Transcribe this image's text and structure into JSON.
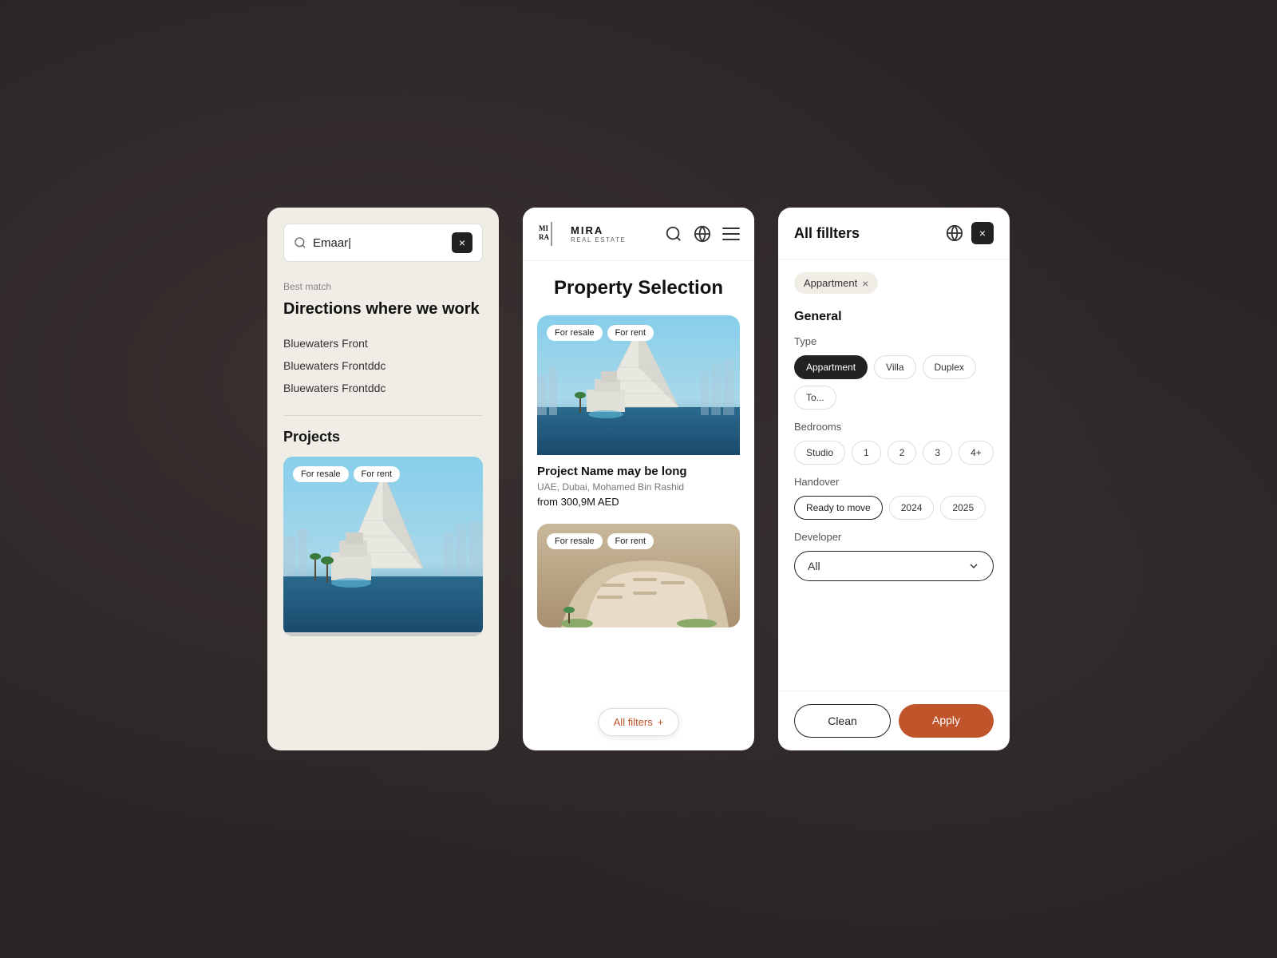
{
  "panel1": {
    "search_value": "Emaar|",
    "close_label": "×",
    "best_match": "Best match",
    "directions_heading": "Directions where we work",
    "locations": [
      "Bluewaters Front",
      "Bluewaters Frontddc",
      "Bluewaters Frontddc"
    ],
    "projects_heading": "Projects",
    "project_badge1": "For resale",
    "project_badge2": "For rent"
  },
  "panel2": {
    "logo_text": "MIRA",
    "logo_sub": "REAL ESTATE",
    "title": "Property Selection",
    "card1": {
      "badge1": "For resale",
      "badge2": "For rent",
      "name": "Project Name may be long",
      "location": "UAE, Dubai, Mohamed Bin Rashid",
      "price": "from 300,9M AED"
    },
    "card2": {
      "badge1": "For resale",
      "badge2": "For rent"
    },
    "all_filters_label": "All filters",
    "all_filters_plus": "+"
  },
  "panel3": {
    "title": "All fillters",
    "active_tag": "Appartment",
    "tag_close": "×",
    "general_label": "General",
    "type_label": "Type",
    "type_chips": [
      "Appartment",
      "Villa",
      "Duplex",
      "To..."
    ],
    "bedrooms_label": "Bedrooms",
    "bedroom_chips": [
      "Studio",
      "1",
      "2",
      "3",
      "4+"
    ],
    "handover_label": "Handover",
    "handover_chips": [
      "Ready to move",
      "2024",
      "2025",
      "..."
    ],
    "developer_label": "Developer",
    "developer_value": "All",
    "clean_label": "Clean",
    "apply_label": "Apply",
    "close_label": "×"
  }
}
